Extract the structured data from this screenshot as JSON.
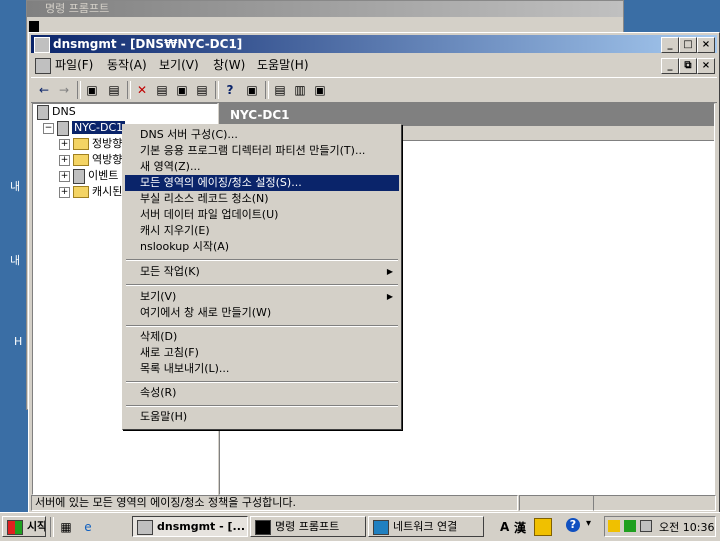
{
  "desktop": {
    "icon_labels": [
      "내",
      "내",
      "H"
    ]
  },
  "background_window": {
    "title": "명령 프롬프트"
  },
  "window": {
    "title": "dnsmgmt - [DNS₩NYC-DC1]",
    "minimize": "_",
    "restore": "□",
    "close": "×"
  },
  "menu": [
    "파일(F)",
    "동작(A)",
    "보기(V)",
    "창(W)",
    "도움말(H)"
  ],
  "inner_controls": [
    "_",
    "⧉",
    "×"
  ],
  "toolbar": [
    "←",
    "→",
    "▣",
    "▤",
    "✕",
    "▤",
    "▣",
    "▤",
    "?",
    "▣",
    "▤",
    "▥",
    "▣"
  ],
  "tree": {
    "root": "DNS",
    "server": "NYC-DC1",
    "children": [
      "정방향",
      "역방향",
      "이벤트",
      "캐시된"
    ]
  },
  "result": {
    "header": "NYC-DC1"
  },
  "context_menu": {
    "groups": [
      [
        "DNS 서버 구성(C)...",
        "기본 응용 프로그램 디렉터리 파티션 만들기(T)...",
        "새 영역(Z)...",
        "모든 영역의 에이징/청소 설정(S)...",
        "부실 리소스 레코드 청소(N)",
        "서버 데이터 파일 업데이트(U)",
        "캐시 지우기(E)",
        "nslookup 시작(A)"
      ],
      [
        "모든 작업(K)"
      ],
      [
        "보기(V)",
        "여기에서 창 새로 만들기(W)"
      ],
      [
        "삭제(D)",
        "새로 고침(F)",
        "목록 내보내기(L)..."
      ],
      [
        "속성(R)"
      ],
      [
        "도움말(H)"
      ]
    ],
    "selected": "모든 영역의 에이징/청소 설정(S)...",
    "submenu_items": [
      "모든 작업(K)",
      "보기(V)"
    ]
  },
  "statusbar": {
    "text": "서버에 있는 모든 영역의 에이징/청소 정책을 구성합니다."
  },
  "taskbar": {
    "start": "시작",
    "tasks": [
      "dnsmgmt - [...",
      "명령 프롬프트",
      "네트워크 연결"
    ],
    "tray": [
      "A",
      "漢",
      "?"
    ],
    "clock": "오전 10:36"
  }
}
